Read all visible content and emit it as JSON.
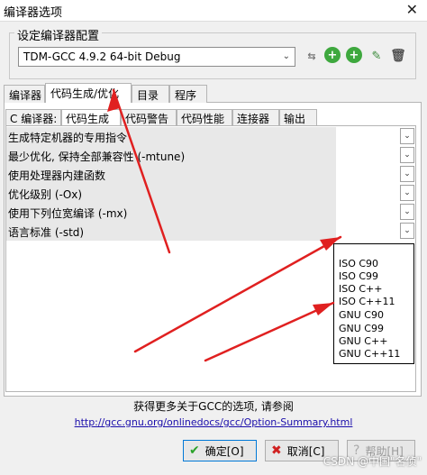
{
  "window": {
    "title": "编译器选项",
    "close": "✕"
  },
  "compiler_set": {
    "legend": "设定编译器配置",
    "selected": "TDM-GCC 4.9.2 64-bit Debug",
    "arrow": "⌄"
  },
  "toolbar_glyphs": {
    "arrows": "⇆",
    "plus": "+",
    "edit": "✎",
    "trash": "🗑"
  },
  "tabs": [
    {
      "label": "编译器"
    },
    {
      "label": "代码生成/优化"
    },
    {
      "label": "目录"
    },
    {
      "label": "程序"
    }
  ],
  "subtabs": [
    {
      "label": "C 编译器:"
    },
    {
      "label": "代码生成"
    },
    {
      "label": "代码警告"
    },
    {
      "label": "代码性能"
    },
    {
      "label": "连接器"
    },
    {
      "label": "输出"
    }
  ],
  "settings": [
    {
      "label": "生成特定机器的专用指令"
    },
    {
      "label": "最少优化, 保持全部兼容性 (-mtune)"
    },
    {
      "label": "使用处理器内建函数"
    },
    {
      "label": "优化级别 (-Ox)"
    },
    {
      "label": "使用下列位宽编译 (-mx)"
    },
    {
      "label": "语言标准 (-std)"
    }
  ],
  "row_dropdown_glyph": "⌄",
  "dropdown_options": [
    "ISO C90",
    "ISO C99",
    "ISO C++",
    "ISO C++11",
    "GNU C90",
    "GNU C99",
    "GNU C++",
    "GNU C++11"
  ],
  "info": {
    "text": "获得更多关于GCC的选项, 请参阅",
    "link": "http://gcc.gnu.org/onlinedocs/gcc/Option-Summary.html"
  },
  "buttons": {
    "ok": "确定[O]",
    "cancel": "取消[C]",
    "help": "帮助[H]",
    "ok_glyph": "✔",
    "cancel_glyph": "✖",
    "help_glyph": "?"
  },
  "watermark": "CSDN @中国\"名侦\"",
  "colors": {
    "arrow": "#e02020",
    "ok_accent": "#2aa22a",
    "cancel_accent": "#d02020",
    "link": "#1a0dab"
  }
}
